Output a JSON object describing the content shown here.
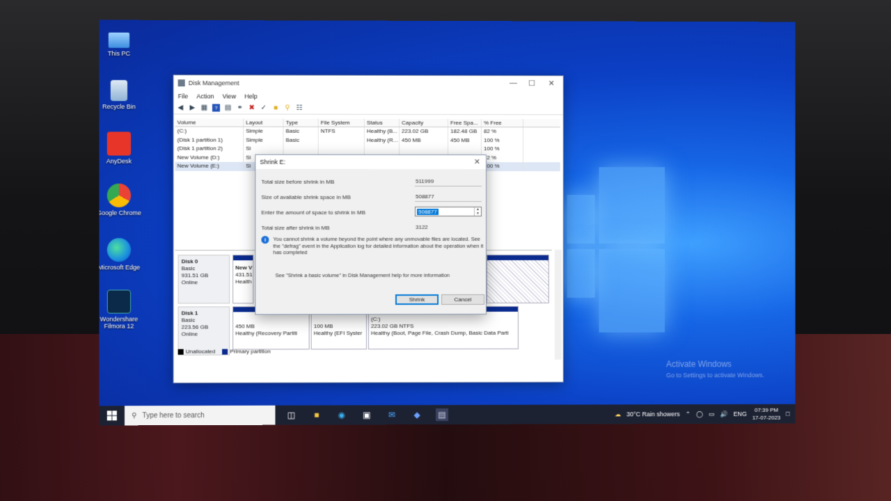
{
  "desktop": {
    "icons": [
      {
        "label": "This PC"
      },
      {
        "label": "Recycle Bin"
      },
      {
        "label": "AnyDesk"
      },
      {
        "label": "Google Chrome"
      },
      {
        "label": "Microsoft Edge"
      },
      {
        "label": "Wondershare Filmora 12"
      }
    ],
    "watermark": {
      "title": "Activate Windows",
      "subtitle": "Go to Settings to activate Windows."
    }
  },
  "window": {
    "title": "Disk Management",
    "menu": [
      "File",
      "Action",
      "View",
      "Help"
    ],
    "columns": [
      "Volume",
      "Layout",
      "Type",
      "File System",
      "Status",
      "Capacity",
      "Free Spa...",
      "% Free"
    ],
    "volumes": [
      [
        "(C:)",
        "Simple",
        "Basic",
        "NTFS",
        "Healthy (B...",
        "223.02 GB",
        "182.48 GB",
        "82 %"
      ],
      [
        "(Disk 1 partition 1)",
        "Simple",
        "Basic",
        "",
        "Healthy (R...",
        "450 MB",
        "450 MB",
        "100 %"
      ],
      [
        "(Disk 1 partition 2)",
        "Si",
        "",
        "",
        "",
        "",
        "",
        "100 %"
      ],
      [
        "New Volume (D:)",
        "Si",
        "",
        "",
        "",
        "",
        "",
        "92 %"
      ],
      [
        "New Volume (E:)",
        "Si",
        "",
        "",
        "",
        "",
        "",
        "100 %"
      ]
    ],
    "disks": [
      {
        "name": "Disk 0",
        "type": "Basic",
        "size": "931.51 GB",
        "state": "Online",
        "parts": [
          {
            "title": "New V",
            "size": "431.51",
            "status": "Health"
          }
        ]
      },
      {
        "name": "Disk 1",
        "type": "Basic",
        "size": "223.56 GB",
        "state": "Online",
        "parts": [
          {
            "title": "",
            "size": "450 MB",
            "status": "Healthy (Recovery Partiti"
          },
          {
            "title": "",
            "size": "100 MB",
            "status": "Healthy (EFI Syster"
          },
          {
            "title": "(C:)",
            "size": "223.02 GB NTFS",
            "status": "Healthy (Boot, Page File, Crash Dump, Basic Data Parti"
          }
        ]
      }
    ],
    "legend": {
      "unallocated": "Unallocated",
      "primary": "Primary partition"
    }
  },
  "dialog": {
    "title": "Shrink E:",
    "total_before_label": "Total size before shrink in MB",
    "total_before": "511999",
    "available_label": "Size of available shrink space in MB",
    "available": "508877",
    "amount_label": "Enter the amount of space to shrink in MB",
    "amount": "508877",
    "after_label": "Total size after shrink in MB",
    "after": "3122",
    "info": "You cannot shrink a volume beyond the point where any unmovable files are located. See the \"defrag\" event in the Application log for detailed information about the operation when it has completed",
    "help": "See \"Shrink a basic volume\" in Disk Management help for more information",
    "shrink_label": "Shrink",
    "cancel_label": "Cancel"
  },
  "taskbar": {
    "search_placeholder": "Type here to search",
    "weather": "30°C  Rain showers",
    "lang": "ENG",
    "time": "07:39 PM",
    "date": "17-07-2023"
  },
  "colors": {
    "accent": "#0078d7",
    "primary_partition": "#0a2a8e",
    "taskbar": "#1d2233"
  }
}
